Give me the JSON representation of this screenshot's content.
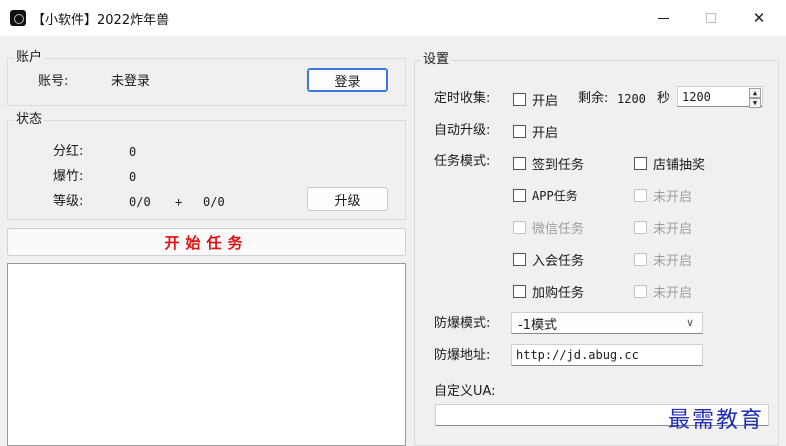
{
  "window": {
    "title": "【小软件】2022炸年兽",
    "minimize_glyph": "—",
    "close_glyph": "✕"
  },
  "account": {
    "group_title": "账户",
    "label": "账号:",
    "value": "未登录",
    "login_button": "登录"
  },
  "status": {
    "group_title": "状态",
    "dividend_label": "分红:",
    "dividend_value": "0",
    "firecracker_label": "爆竹:",
    "firecracker_value": "0",
    "level_label": "等级:",
    "level_value_a": "0/0",
    "level_plus": "+",
    "level_value_b": "0/0",
    "upgrade_button": "升级"
  },
  "start_button": "开始任务",
  "settings": {
    "group_title": "设置",
    "timed_collect_label": "定时收集:",
    "timed_collect_checkbox": "开启",
    "remaining_label": "剩余:",
    "remaining_value": "1200",
    "seconds_label": "秒",
    "interval_value": "1200",
    "auto_upgrade_label": "自动升级:",
    "auto_upgrade_checkbox": "开启",
    "task_mode_label": "任务模式:",
    "tasks": [
      {
        "label": "签到任务",
        "enabled": true
      },
      {
        "label": "店铺抽奖",
        "enabled": true
      },
      {
        "label": "APP任务",
        "enabled": true
      },
      {
        "label": "未开启",
        "enabled": false
      },
      {
        "label": "微信任务",
        "enabled": false
      },
      {
        "label": "未开启",
        "enabled": false
      },
      {
        "label": "入会任务",
        "enabled": true
      },
      {
        "label": "未开启",
        "enabled": false
      },
      {
        "label": "加购任务",
        "enabled": true
      },
      {
        "label": "未开启",
        "enabled": false
      }
    ],
    "anti_burst_mode_label": "防爆模式:",
    "anti_burst_mode_value": "-1模式",
    "anti_burst_address_label": "防爆地址:",
    "anti_burst_address_value": "http://jd.abug.cc",
    "custom_ua_label": "自定义UA:",
    "custom_ua_value": ""
  },
  "watermark": "最需教育",
  "icons": {
    "app": "app-logo-icon",
    "minimize": "minimize-icon",
    "maximize": "maximize-icon",
    "close": "close-icon",
    "chevron": "chevron-down-icon",
    "spin_up": "spin-up-icon",
    "spin_down": "spin-down-icon"
  }
}
